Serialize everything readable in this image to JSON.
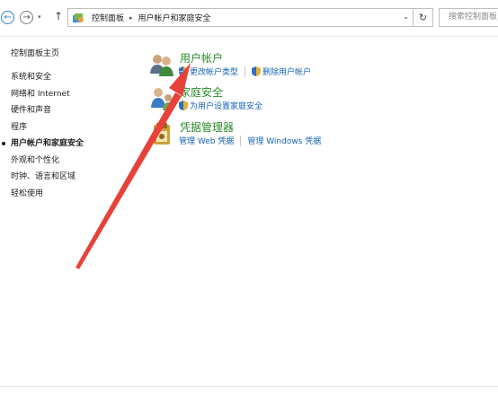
{
  "address": {
    "segments": [
      "控制面板",
      "用户帐户和家庭安全"
    ],
    "search_placeholder": "搜索控制面板"
  },
  "sidebar": {
    "home": "控制面板主页",
    "items": [
      {
        "label": "系统和安全",
        "active": false
      },
      {
        "label": "网络和 Internet",
        "active": false
      },
      {
        "label": "硬件和声音",
        "active": false
      },
      {
        "label": "程序",
        "active": false
      },
      {
        "label": "用户帐户和家庭安全",
        "active": true
      },
      {
        "label": "外观和个性化",
        "active": false
      },
      {
        "label": "时钟、语言和区域",
        "active": false
      },
      {
        "label": "轻松使用",
        "active": false
      }
    ]
  },
  "categories": [
    {
      "title": "用户帐户",
      "links": [
        "更改帐户类型",
        "删除用户帐户"
      ]
    },
    {
      "title": "家庭安全",
      "links": [
        "为用户设置家庭安全"
      ]
    },
    {
      "title": "凭据管理器",
      "links": [
        "管理 Web 凭据",
        "管理 Windows 凭据"
      ]
    }
  ],
  "colors": {
    "category_title": "#2a8a2a",
    "link": "#1563b8",
    "annotation_arrow": "#e8413a"
  }
}
